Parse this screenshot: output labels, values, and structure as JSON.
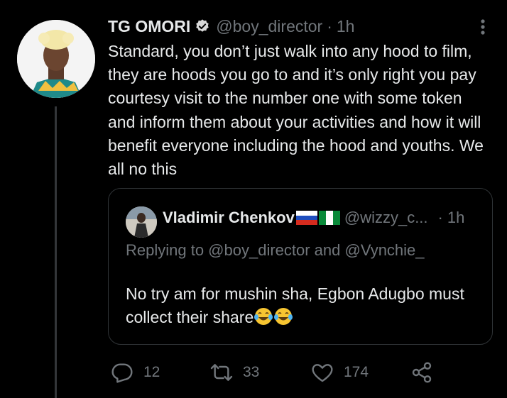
{
  "tweet": {
    "author_name": "TG OMORI",
    "handle": "@boy_director",
    "separator": "·",
    "time": "1h",
    "text": "Standard, you don’t just walk into any hood to film, they are hoods you go to and it’s only right you pay courtesy visit to the number one with some token and inform them about your activities and how it will benefit everyone including the hood and youths. We all no this"
  },
  "quote": {
    "author_name": "Vladimir Chenkov",
    "handle": "@wizzy_c...",
    "separator": "·",
    "time": "1h",
    "replying_to": "Replying to @boy_director and @Vynchie_",
    "text": "No try am for mushin sha, Egbon Adugbo must collect their share"
  },
  "actions": {
    "reply_count": "12",
    "retweet_count": "33",
    "like_count": "174"
  },
  "colors": {
    "background": "#000000",
    "text": "#e7e9ea",
    "muted": "#71767b",
    "border": "#2f3336"
  },
  "icons": [
    "verified-badge-icon",
    "more-options-icon",
    "russia-flag-icon",
    "nigeria-flag-icon",
    "laughing-tears-emoji-icon",
    "reply-icon",
    "retweet-icon",
    "like-icon",
    "share-icon"
  ]
}
